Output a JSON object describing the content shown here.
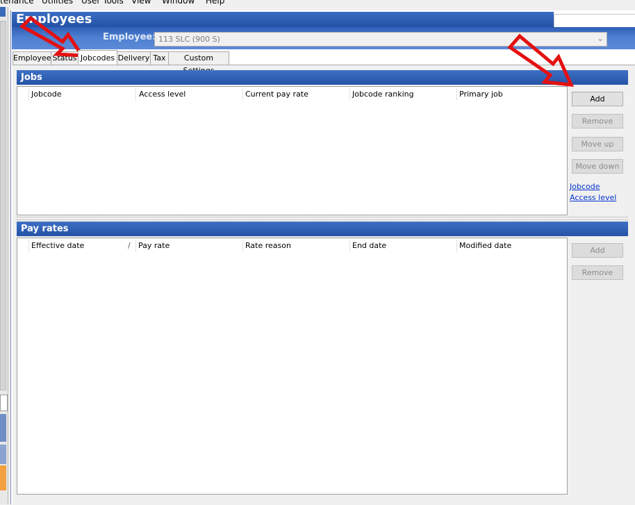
{
  "menubar": {
    "items": [
      "tenance",
      "Utilities",
      "User Tools",
      "View",
      "Window",
      "Help"
    ]
  },
  "window": {
    "title": "Employees"
  },
  "employee": {
    "label": "Employee:",
    "selected": "113  SLC (900 S)"
  },
  "tabs": [
    {
      "label": "Employee",
      "selected": false
    },
    {
      "label": "Status",
      "selected": false
    },
    {
      "label": "Jobcodes",
      "selected": true
    },
    {
      "label": "Delivery",
      "selected": false
    },
    {
      "label": "Tax",
      "selected": false
    },
    {
      "label": "Custom Settings",
      "selected": false
    }
  ],
  "jobs": {
    "title": "Jobs",
    "columns": [
      "Jobcode",
      "Access level",
      "Current pay rate",
      "Jobcode ranking",
      "Primary job"
    ],
    "buttons": {
      "add": "Add",
      "remove": "Remove",
      "move_up": "Move up",
      "move_down": "Move down"
    },
    "links": {
      "jobcode": "Jobcode",
      "access_level": "Access level"
    }
  },
  "pay_rates": {
    "title": "Pay rates",
    "columns": [
      "Effective date",
      "Pay rate",
      "Rate reason",
      "End date",
      "Modified date"
    ],
    "sort_indicator": "/",
    "buttons": {
      "add": "Add",
      "remove": "Remove"
    }
  },
  "icons": {
    "dropdown": "chevron-down-icon",
    "annotations": "red-arrow-icon"
  },
  "colors": {
    "header_blue": "#2553a6",
    "annotation_red": "#e41010",
    "link_blue": "#0033cc"
  }
}
